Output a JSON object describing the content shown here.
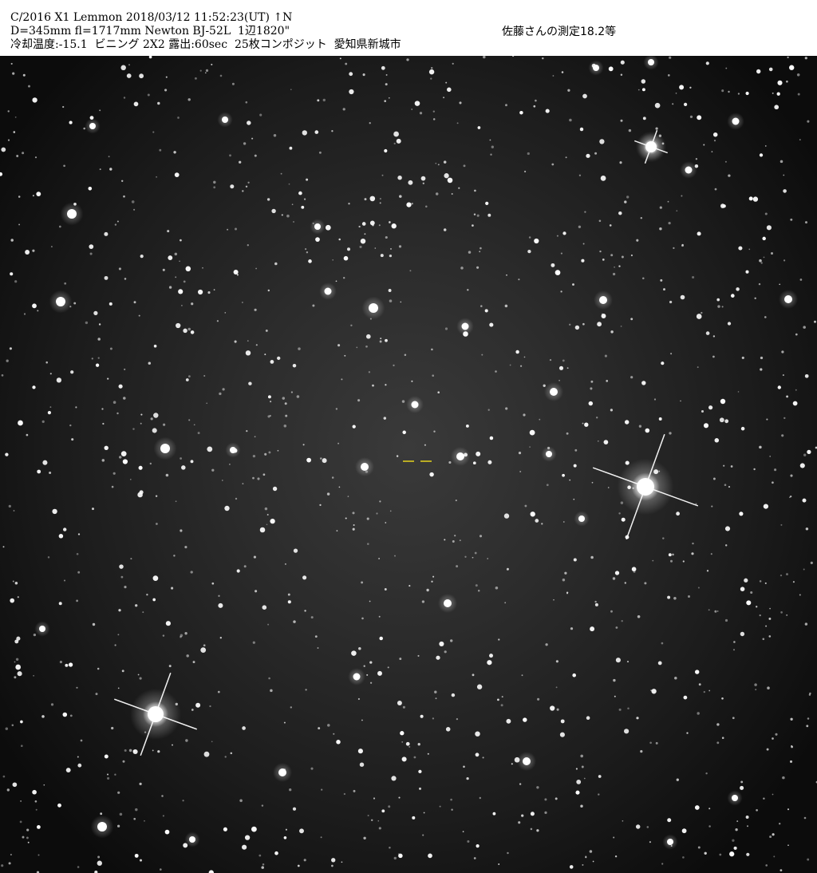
{
  "caption": {
    "line1": "C/2016 X1 Lemmon 2018/03/12 11:52:23(UT) ↑N",
    "line2": "D=345mm fl=1717mm Newton BJ-52L  1辺1820\"",
    "line3": "冷却温度:-15.1  ビニング 2X2 露出:60sec  25枚コンポジット  愛知県新城市",
    "measurement": "佐藤さんの測定18.2等"
  },
  "colors": {
    "header_background": "#ffffff",
    "caption_text": "#000000",
    "sky_background": "#1c1c1c",
    "star": "#ffffff",
    "comet_marker": "#e6d21e"
  },
  "image": {
    "content": "star field with comet C/2016 X1 Lemmon marked by two short yellow tick marks near center"
  }
}
